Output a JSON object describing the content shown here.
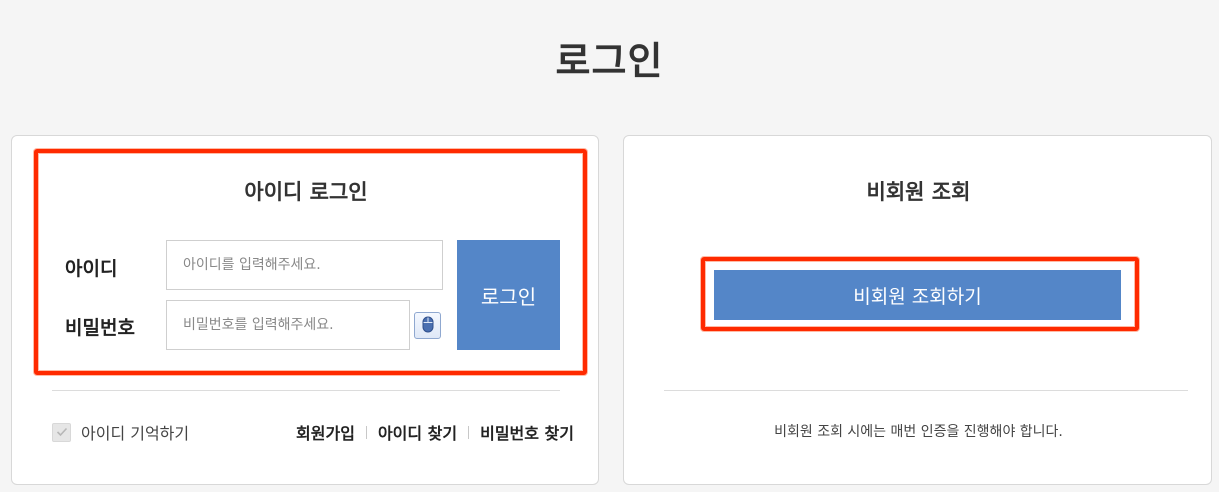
{
  "page": {
    "title": "로그인"
  },
  "member_login": {
    "title": "아이디 로그인",
    "id_label": "아이디",
    "id_placeholder": "아이디를 입력해주세요.",
    "pw_label": "비밀번호",
    "pw_placeholder": "비밀번호를 입력해주세요.",
    "login_button": "로그인",
    "remember_label": "아이디 기억하기",
    "remember_checked": true,
    "links": [
      "회원가입",
      "아이디 찾기",
      "비밀번호 찾기"
    ]
  },
  "guest_lookup": {
    "title": "비회원 조회",
    "button": "비회원 조회하기",
    "notice": "비회원 조회 시에는 매번 인증을 진행해야 합니다."
  },
  "colors": {
    "primary_button": "#5486c8",
    "highlight": "#ff2a00",
    "background": "#f5f5f5"
  },
  "icons": {
    "keyboard_toggle": "mouse-icon",
    "remember_check": "check-icon"
  }
}
